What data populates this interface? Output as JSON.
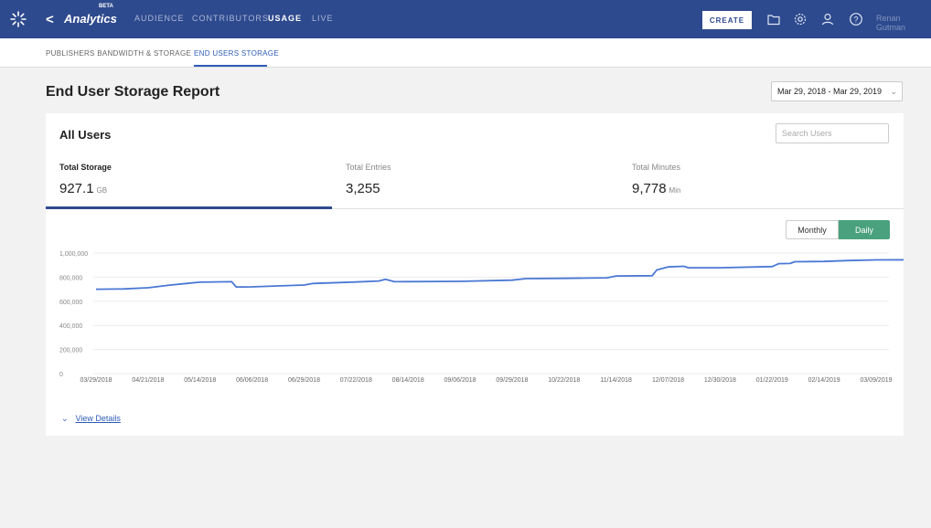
{
  "topbar": {
    "app_title": "Analytics",
    "beta_label": "BETA",
    "nav": [
      "AUDIENCE",
      "CONTRIBUTORS",
      "USAGE",
      "LIVE"
    ],
    "create_label": "CREATE",
    "user_name": "Renan Gutman"
  },
  "subtabs": [
    "PUBLISHERS BANDWIDTH & STORAGE",
    "END USERS STORAGE"
  ],
  "page": {
    "title": "End User Storage Report",
    "date_range": "Mar 29, 2018 - Mar 29, 2019"
  },
  "card": {
    "title": "All Users",
    "search_placeholder": "Search Users",
    "metrics": {
      "storage": {
        "label": "Total Storage",
        "value": "927.1",
        "unit": "GB"
      },
      "entries": {
        "label": "Total Entries",
        "value": "3,255"
      },
      "minutes": {
        "label": "Total Minutes",
        "value": "9,778",
        "unit": "Min"
      }
    },
    "toggle": {
      "monthly": "Monthly",
      "daily": "Daily"
    },
    "view_details": "View Details"
  },
  "colors": {
    "accent": "#2e4a8e",
    "line": "#4a78d4",
    "daily_active": "#4aa17e"
  },
  "chart_data": {
    "type": "line",
    "ylim": [
      0,
      1000000
    ],
    "yticks": [
      "0",
      "200,000",
      "400,000",
      "600,000",
      "800,000",
      "1,000,000"
    ],
    "ytick_values": [
      0,
      200000,
      400000,
      600000,
      800000,
      1000000
    ],
    "xticks": [
      "03/29/2018",
      "04/21/2018",
      "05/14/2018",
      "06/06/2018",
      "06/29/2018",
      "07/22/2018",
      "08/14/2018",
      "09/06/2018",
      "09/29/2018",
      "10/22/2018",
      "11/14/2018",
      "12/07/2018",
      "12/30/2018",
      "01/22/2019",
      "02/14/2019",
      "03/09/2019"
    ],
    "series": [
      {
        "points": [
          [
            "03/29/2018",
            700000
          ],
          [
            "04/10/2018",
            702000
          ],
          [
            "04/21/2018",
            712000
          ],
          [
            "05/01/2018",
            735000
          ],
          [
            "05/08/2018",
            748000
          ],
          [
            "05/14/2018",
            758000
          ],
          [
            "05/28/2018",
            762000
          ],
          [
            "05/30/2018",
            718000
          ],
          [
            "06/06/2018",
            720000
          ],
          [
            "06/29/2018",
            735000
          ],
          [
            "07/03/2018",
            748000
          ],
          [
            "07/22/2018",
            760000
          ],
          [
            "08/01/2018",
            768000
          ],
          [
            "08/04/2018",
            782000
          ],
          [
            "08/08/2018",
            762000
          ],
          [
            "08/14/2018",
            763000
          ],
          [
            "09/06/2018",
            765000
          ],
          [
            "09/29/2018",
            775000
          ],
          [
            "10/05/2018",
            788000
          ],
          [
            "10/22/2018",
            790000
          ],
          [
            "11/10/2018",
            795000
          ],
          [
            "11/14/2018",
            810000
          ],
          [
            "11/30/2018",
            812000
          ],
          [
            "12/02/2018",
            860000
          ],
          [
            "12/07/2018",
            885000
          ],
          [
            "12/14/2018",
            890000
          ],
          [
            "12/16/2018",
            878000
          ],
          [
            "12/30/2018",
            878000
          ],
          [
            "01/22/2019",
            888000
          ],
          [
            "01/25/2019",
            912000
          ],
          [
            "01/30/2019",
            914000
          ],
          [
            "02/01/2019",
            928000
          ],
          [
            "02/14/2019",
            930000
          ],
          [
            "02/25/2019",
            938000
          ],
          [
            "03/09/2019",
            943000
          ],
          [
            "03/29/2019",
            944000
          ]
        ]
      }
    ]
  }
}
